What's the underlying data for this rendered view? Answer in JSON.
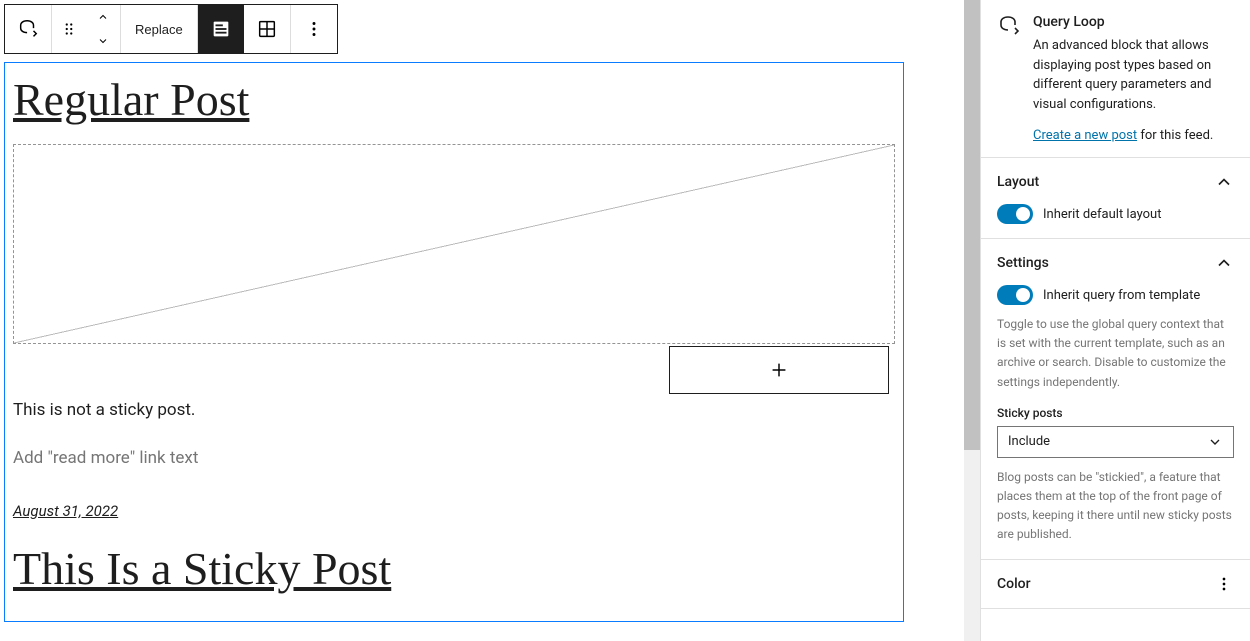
{
  "toolbar": {
    "replace_label": "Replace"
  },
  "posts": [
    {
      "title": "Regular Post",
      "excerpt": "This is not a sticky post.",
      "readmore_placeholder": "Add \"read more\" link text",
      "date": "August 31, 2022"
    },
    {
      "title": "This Is a Sticky Post"
    }
  ],
  "sidebar": {
    "block": {
      "name": "Query Loop",
      "description": "An advanced block that allows displaying post types based on different query parameters and visual configurations.",
      "create_link": "Create a new post",
      "feed_suffix": " for this feed."
    },
    "layout": {
      "title": "Layout",
      "toggle_label": "Inherit default layout"
    },
    "settings": {
      "title": "Settings",
      "toggle_label": "Inherit query from template",
      "help": "Toggle to use the global query context that is set with the current template, such as an archive or search. Disable to customize the settings independently.",
      "sticky_label": "Sticky posts",
      "sticky_value": "Include",
      "sticky_help": "Blog posts can be \"stickied\", a feature that places them at the top of the front page of posts, keeping it there until new sticky posts are published."
    },
    "color": {
      "title": "Color"
    }
  }
}
